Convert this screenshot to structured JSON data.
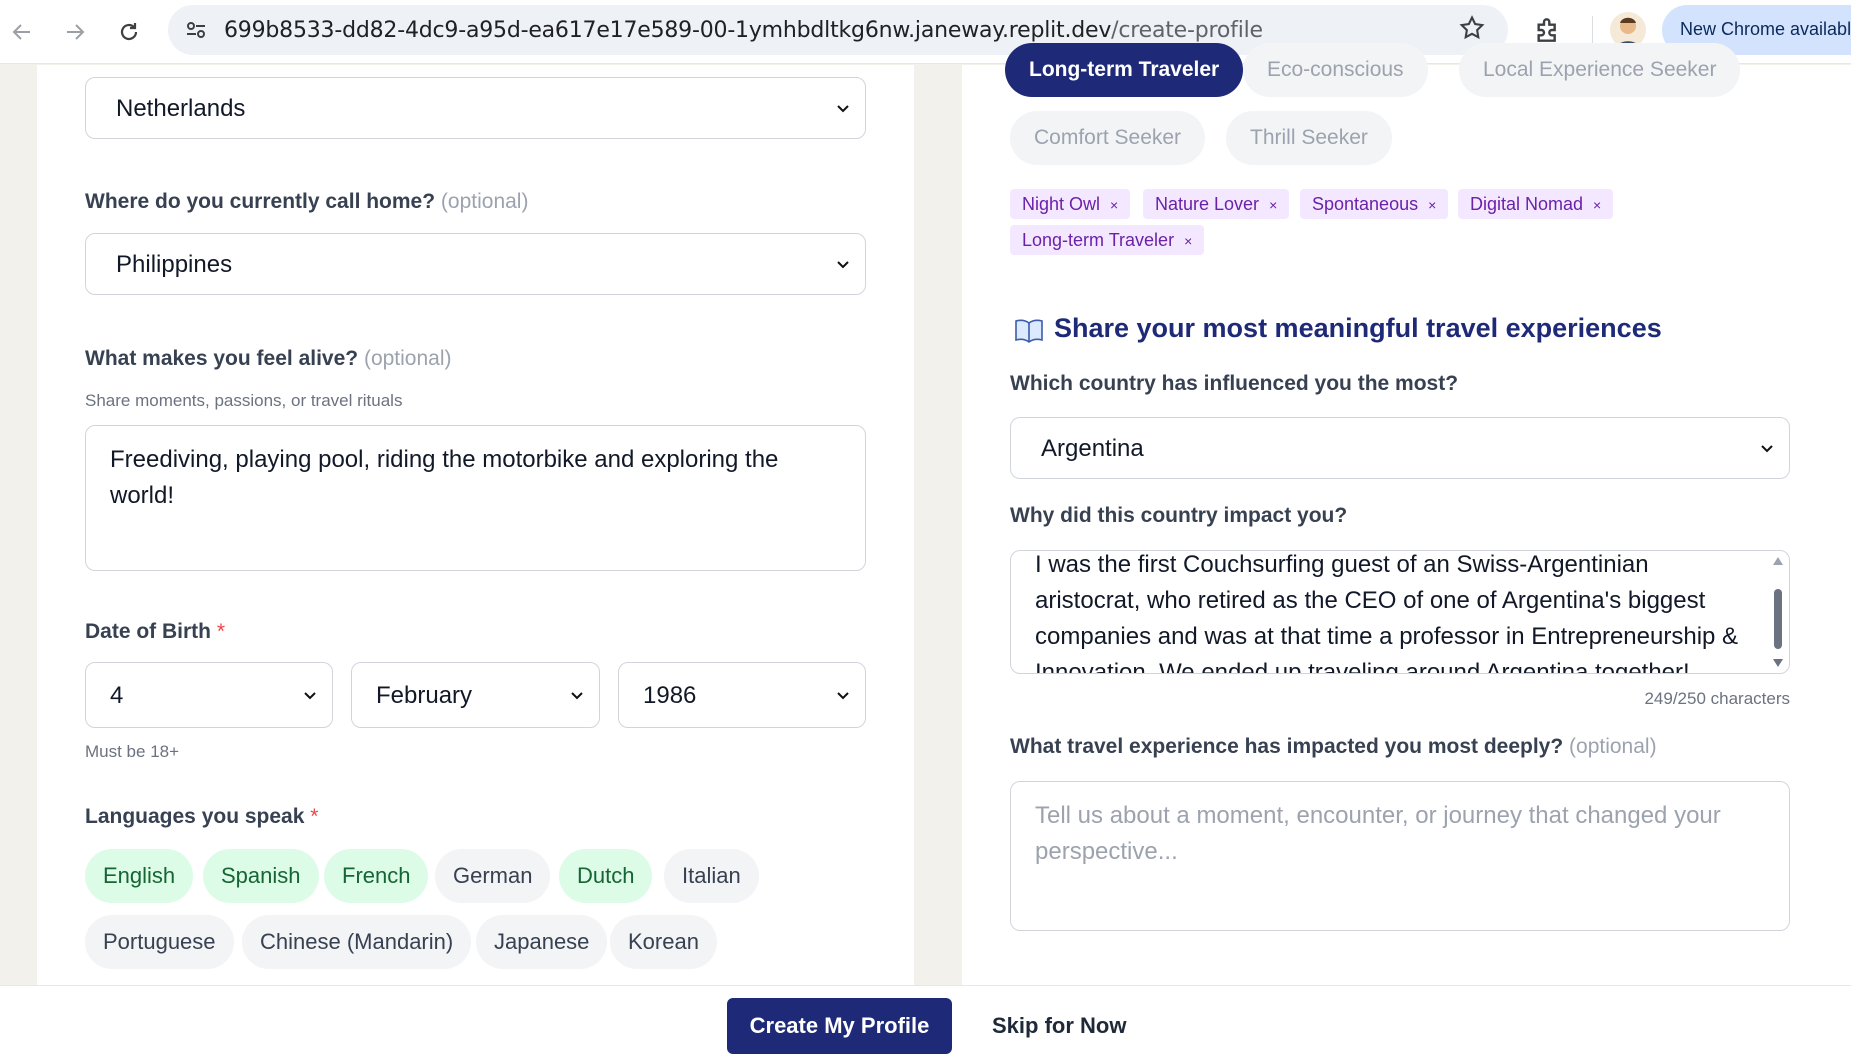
{
  "browser": {
    "url_domain": "699b8533-dd82-4dc9-a95d-ea617e17e589-00-1ymhbdltkg6nw.janeway.replit.dev",
    "url_path": "/create-profile",
    "update_label": "New Chrome available"
  },
  "left": {
    "nationality_value": "Netherlands",
    "home_label": "Where do you currently call home?",
    "home_optional": "(optional)",
    "home_value": "Philippines",
    "alive_label": "What makes you feel alive?",
    "alive_optional": "(optional)",
    "alive_hint": "Share moments, passions, or travel rituals",
    "alive_value": "Freediving, playing pool, riding the motorbike and exploring the world!",
    "dob_label": "Date of Birth",
    "required_mark": "*",
    "dob_day": "4",
    "dob_month": "February",
    "dob_year": "1986",
    "dob_hint": "Must be 18+",
    "languages_label": "Languages you speak",
    "languages": [
      {
        "label": "English",
        "selected": true
      },
      {
        "label": "Spanish",
        "selected": true
      },
      {
        "label": "French",
        "selected": true
      },
      {
        "label": "German",
        "selected": false
      },
      {
        "label": "Dutch",
        "selected": true
      },
      {
        "label": "Italian",
        "selected": false
      },
      {
        "label": "Portuguese",
        "selected": false
      },
      {
        "label": "Chinese (Mandarin)",
        "selected": false
      },
      {
        "label": "Japanese",
        "selected": false
      },
      {
        "label": "Korean",
        "selected": false
      }
    ]
  },
  "right": {
    "traits": [
      {
        "label": "Long-term Traveler",
        "selected": true
      },
      {
        "label": "Eco-conscious",
        "selected": false
      },
      {
        "label": "Local Experience Seeker",
        "selected": false
      },
      {
        "label": "Comfort Seeker",
        "selected": false
      },
      {
        "label": "Thrill Seeker",
        "selected": false
      }
    ],
    "selected_tags": [
      "Night Owl",
      "Nature Lover",
      "Spontaneous",
      "Digital Nomad",
      "Long-term Traveler"
    ],
    "tag_remove_glyph": "×",
    "section_icon": "open-book-icon",
    "section_title": "Share your most meaningful travel experiences",
    "country_label": "Which country has influenced you the most?",
    "country_value": "Argentina",
    "why_label": "Why did this country impact you?",
    "why_value": "I was the first Couchsurfing guest of an Swiss-Argentinian aristocrat, who retired as the CEO of one of Argentina's biggest companies and was at that time a professor in Entrepreneurship & Innovation. We ended up traveling around Argentina together!",
    "char_count": "249/250 characters",
    "experience_label": "What travel experience has impacted you most deeply?",
    "experience_optional": "(optional)",
    "experience_placeholder": "Tell us about a moment, encounter, or journey that changed your perspective..."
  },
  "footer": {
    "create_label": "Create My Profile",
    "skip_label": "Skip for Now"
  },
  "colors": {
    "brand_navy": "#1e2a78",
    "selected_language_bg": "#dcfce7",
    "tag_bg": "#f3e8ff",
    "required_red": "#ef4444"
  }
}
